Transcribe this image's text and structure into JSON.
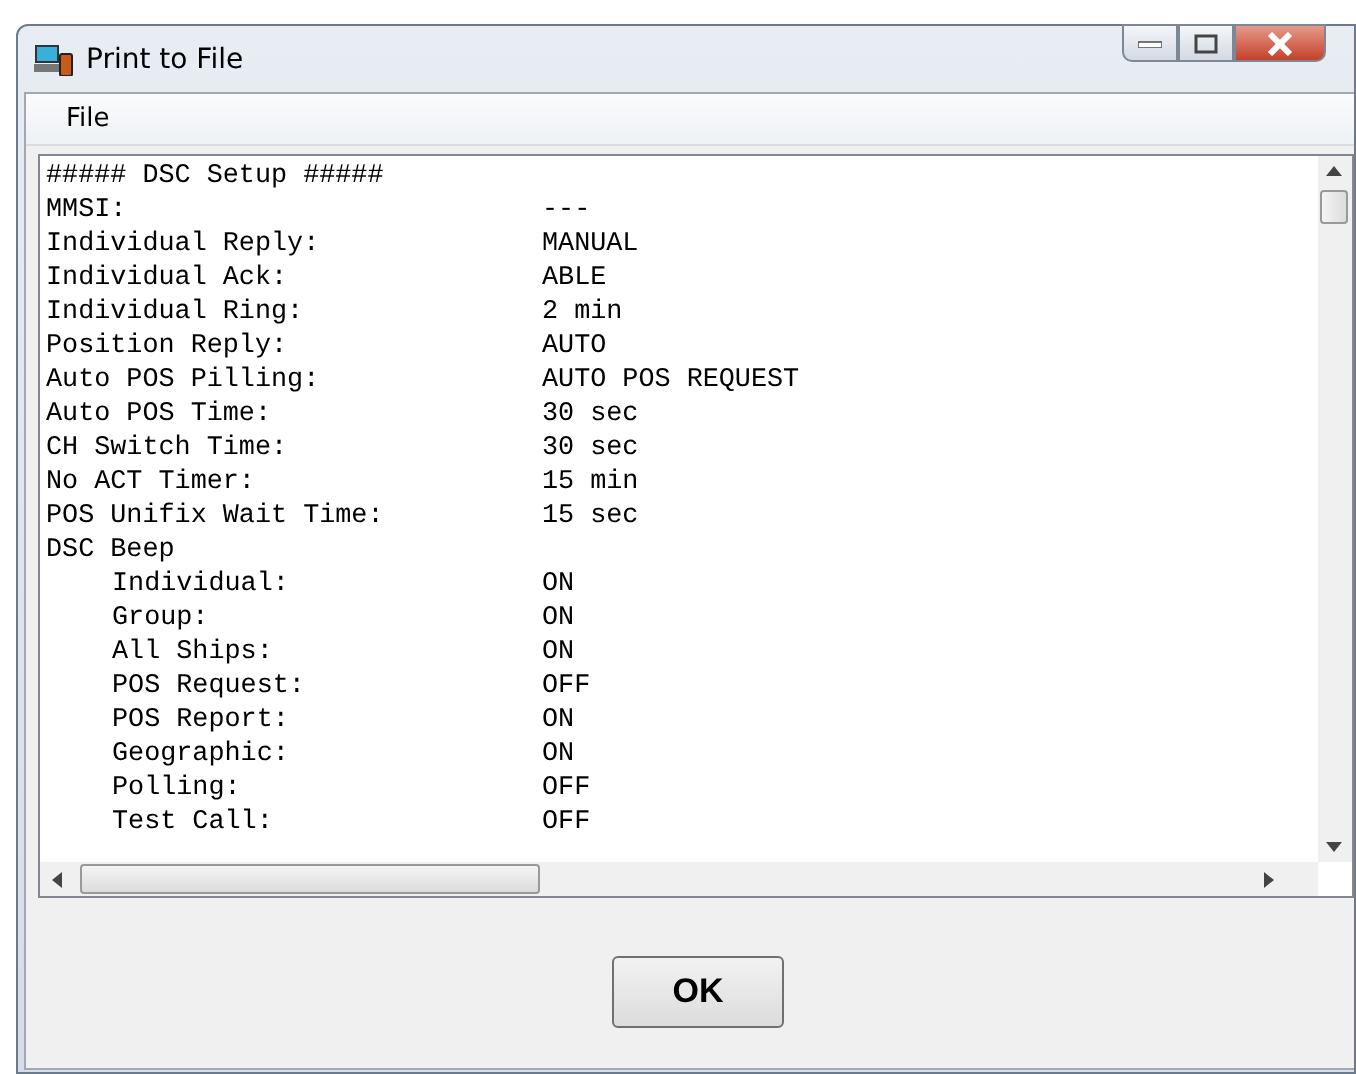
{
  "window": {
    "title": "Print to File"
  },
  "menu": [
    {
      "label": "File"
    }
  ],
  "document": {
    "heading": "##### DSC Setup #####",
    "lines": [
      {
        "label": "MMSI:",
        "value": "---"
      },
      {
        "label": "Individual Reply:",
        "value": "MANUAL"
      },
      {
        "label": "Individual Ack:",
        "value": "ABLE"
      },
      {
        "label": "Individual Ring:",
        "value": "2 min"
      },
      {
        "label": "Position Reply:",
        "value": "AUTO"
      },
      {
        "label": "Auto POS Pilling:",
        "value": "AUTO POS REQUEST"
      },
      {
        "label": "Auto POS Time:",
        "value": "30 sec"
      },
      {
        "label": "CH Switch Time:",
        "value": "30 sec"
      },
      {
        "label": "No ACT Timer:",
        "value": "15 min"
      },
      {
        "label": "POS Unifix Wait Time:",
        "value": "15 sec"
      },
      {
        "label": "DSC Beep",
        "children": [
          {
            "label": "Individual:",
            "value": "ON"
          },
          {
            "label": "Group:",
            "value": "ON"
          },
          {
            "label": "All Ships:",
            "value": "ON"
          },
          {
            "label": "POS Request:",
            "value": "OFF"
          },
          {
            "label": "POS Report:",
            "value": "ON"
          },
          {
            "label": "Geographic:",
            "value": "ON"
          },
          {
            "label": "Polling:",
            "value": "OFF"
          },
          {
            "label": "Test Call:",
            "value": "OFF"
          }
        ]
      }
    ]
  },
  "buttons": [
    {
      "label": "OK"
    }
  ]
}
